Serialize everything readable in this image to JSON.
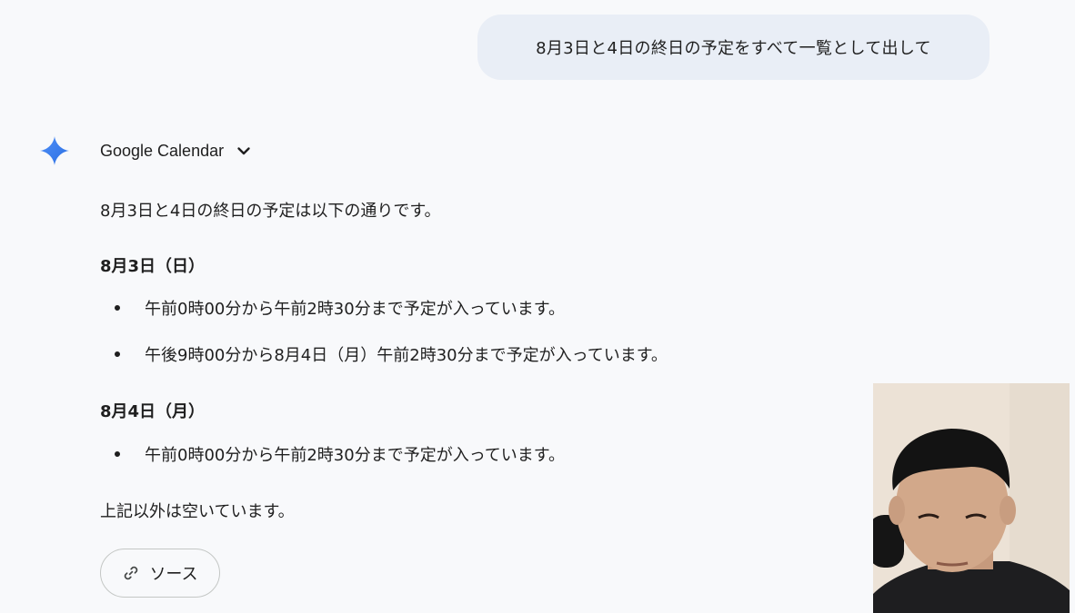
{
  "prompt": {
    "text": "8月3日と4日の終日の予定をすべて一覧として出して"
  },
  "response": {
    "tool_name": "Google Calendar",
    "intro": "8月3日と4日の終日の予定は以下の通りです。",
    "sections": [
      {
        "heading": "8月3日（日）",
        "items": [
          "午前0時00分から午前2時30分まで予定が入っています。",
          "午後9時00分から8月4日（月）午前2時30分まで予定が入っています。"
        ]
      },
      {
        "heading": "8月4日（月）",
        "items": [
          "午前0時00分から午前2時30分まで予定が入っています。"
        ]
      }
    ],
    "closing": "上記以外は空いています。",
    "source_label": "ソース"
  },
  "icons": {
    "assistant": "gemini-sparkle-icon",
    "expand": "chevron-down-icon",
    "source": "link-icon"
  },
  "colors": {
    "background": "#f8f9fb",
    "user_bubble": "#e9eef6",
    "sparkle_blue": "#3b82f6",
    "text": "#1f1f1f"
  }
}
